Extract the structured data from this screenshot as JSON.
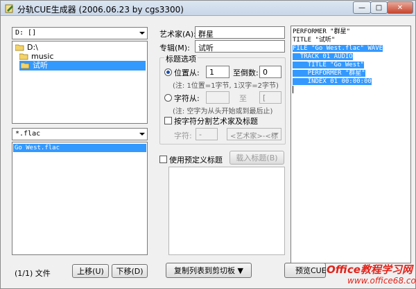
{
  "window": {
    "title": "分轨CUE生成器 (2006.06.23 by cgs3300)",
    "min_glyph": "—",
    "max_glyph": "□",
    "close_glyph": "✕"
  },
  "left": {
    "drive_value": "D: []",
    "folders": [
      {
        "label": "D:\\",
        "selected": false
      },
      {
        "label": "music",
        "selected": false
      },
      {
        "label": "试听",
        "selected": true
      }
    ],
    "filter_value": "*.flac",
    "files": [
      {
        "label": "Go West.flac",
        "selected": true
      }
    ],
    "count_label": "(1/1) 文件",
    "move_up_label": "上移(U)",
    "move_down_label": "下移(D)"
  },
  "middle": {
    "artist_label": "艺术家(A):",
    "artist_value": "群星",
    "album_label": "专辑(M):",
    "album_value": "试听",
    "title_options_label": "标题选项",
    "pos_from_label": "位置从:",
    "pos_from_value": "1",
    "to_last_label": "至倒数:",
    "to_last_value": "0",
    "pos_note": "(注: 1位置=1字节, 1汉字=2字节)",
    "char_from_label": "字符从:",
    "char_to_label": "至",
    "char_to_value": "[",
    "char_note": "(注: 空字为从头开始或到最后止)",
    "split_label": "按字符分割艺术家及标题",
    "char_label": "字符:",
    "char_value": "-",
    "order_value": "<艺术家>-<标",
    "predefined_label": "使用预定义标题",
    "load_titles_label": "载入标题(B)",
    "copy_button_label": "复制列表到剪切板 ▼",
    "preview_button_label": "预览CUE"
  },
  "cue": {
    "lines": [
      {
        "text": "PERFORMER \"群星\"",
        "hl": false
      },
      {
        "text": "TITLE \"试听\"",
        "hl": false
      },
      {
        "text": "FILE \"Go West.flac\" WAVE",
        "hl": true
      },
      {
        "text": "  TRACK 01 AUDIO",
        "hl": true
      },
      {
        "text": "    TITLE \"Go West\"",
        "hl": true
      },
      {
        "text": "    PERFORMER \"群星\"",
        "hl": true
      },
      {
        "text": "    INDEX 01 00:00:00",
        "hl": true
      }
    ]
  },
  "watermark": {
    "top": "Office教程学习网",
    "bottom": "www.office68.com"
  },
  "colors": {
    "selection": "#3399ff",
    "watermark": "#e2231a"
  }
}
